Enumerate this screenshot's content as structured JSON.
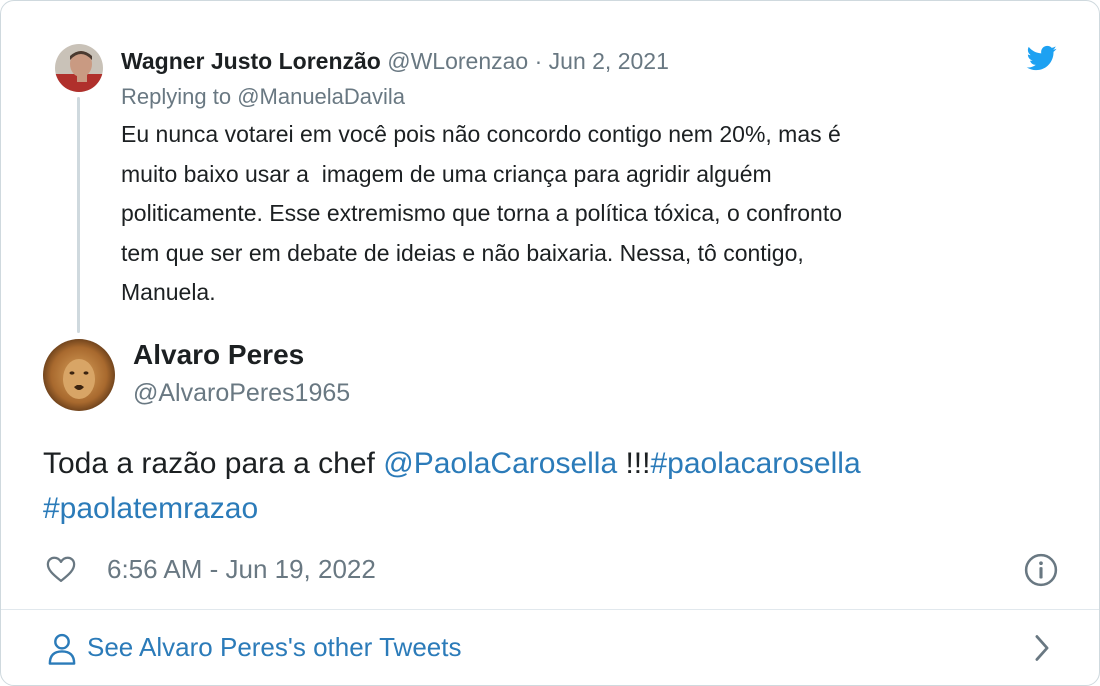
{
  "parent_tweet": {
    "author_name": "Wagner Justo Lorenzão",
    "handle": "@WLorenzao",
    "separator": "·",
    "date": "Jun 2, 2021",
    "replying_to_prefix": "Replying to ",
    "replying_to_handle": "@ManuelaDavila",
    "text": "Eu nunca votarei em você pois não concordo contigo nem 20%, mas é\nmuito baixo usar a  imagem de uma criança para agridir alguém\npoliticamente. Esse extremismo que torna a política tóxica, o confronto\ntem que ser em debate de ideias e não baixaria. Nessa, tô contigo,\nManuela."
  },
  "tweet": {
    "author_name": "Alvaro Peres",
    "handle": "@AlvaroPeres1965",
    "text_prefix": "Toda a razão para a chef ",
    "mention": "@PaolaCarosella",
    "text_middle": " !!!",
    "hashtag_1": "#paolacarosella",
    "hashtag_2": "#paolatemrazao",
    "timestamp": "6:56 AM - Jun 19, 2022"
  },
  "footer": {
    "see_more_label": "See Alvaro Peres's other Tweets"
  },
  "icons": {
    "brand": "twitter-bird-icon",
    "like": "heart-icon",
    "info": "info-icon",
    "profile": "person-icon",
    "chevron": "chevron-right-icon"
  },
  "colors": {
    "link": "#2b7bb9",
    "brand": "#1da1f2",
    "muted": "#697882",
    "text": "#1c2022",
    "border": "#cfd9de"
  }
}
